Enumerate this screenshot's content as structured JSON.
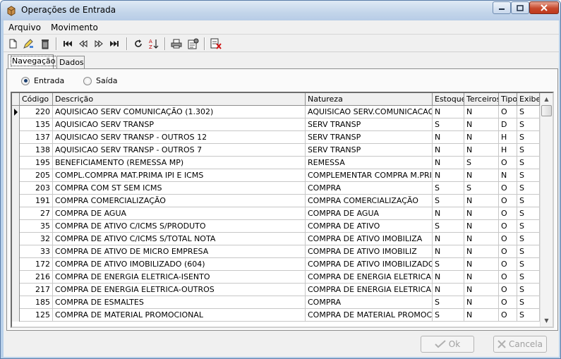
{
  "window": {
    "title": "Operações de Entrada"
  },
  "menu": {
    "items": [
      "Arquivo",
      "Movimento"
    ]
  },
  "toolbar": {
    "icons": [
      "new-icon",
      "edit-icon",
      "delete-icon",
      "first-record-icon",
      "previous-record-icon",
      "next-record-icon",
      "last-record-icon",
      "refresh-icon",
      "sort-icon",
      "print-icon",
      "properties-icon",
      "exit-icon"
    ]
  },
  "tabs": [
    {
      "label": "Navegação",
      "active": true
    },
    {
      "label": "Dados",
      "active": false
    }
  ],
  "filter": {
    "options": [
      {
        "label": "Entrada",
        "selected": true
      },
      {
        "label": "Saída",
        "selected": false
      }
    ]
  },
  "grid": {
    "columns": [
      "Código",
      "Descrição",
      "Natureza",
      "Estoque",
      "Terceiros",
      "Tipo",
      "Exibe"
    ],
    "rows": [
      [
        "220",
        "AQUISICAO SERV COMUNICAÇÃO (1.302)",
        "AQUISICAO SERV.COMUNICACAO",
        "N",
        "N",
        "O",
        "S"
      ],
      [
        "135",
        "AQUISICAO SERV TRANSP",
        "SERV TRANSP",
        "S",
        "N",
        "D",
        "S"
      ],
      [
        "137",
        "AQUISICAO SERV TRANSP - OUTROS 12",
        "SERV TRANSP",
        "N",
        "N",
        "H",
        "S"
      ],
      [
        "138",
        "AQUISICAO SERV TRANSP - OUTROS 7",
        "SERV TRANSP",
        "N",
        "N",
        "H",
        "S"
      ],
      [
        "195",
        "BENEFICIAMENTO (REMESSA MP)",
        "REMESSA",
        "N",
        "S",
        "O",
        "S"
      ],
      [
        "205",
        "COMPL.COMPRA MAT.PRIMA IPI E ICMS",
        "COMPLEMENTAR COMPRA M.PRIM",
        "N",
        "N",
        "N",
        "S"
      ],
      [
        "203",
        "COMPRA COM ST SEM ICMS",
        "COMPRA",
        "S",
        "S",
        "O",
        "S"
      ],
      [
        "191",
        "COMPRA COMERCIALIZAÇÃO",
        "COMPRA COMERCIALIZAÇÃO",
        "S",
        "N",
        "O",
        "S"
      ],
      [
        "27",
        "COMPRA DE AGUA",
        "COMPRA DE AGUA",
        "N",
        "N",
        "O",
        "S"
      ],
      [
        "35",
        "COMPRA DE ATIVO C/ICMS S/PRODUTO",
        "COMPRA DE ATIVO",
        "S",
        "N",
        "O",
        "S"
      ],
      [
        "32",
        "COMPRA DE ATIVO C/ICMS S/TOTAL NOTA",
        "COMPRA DE ATIVO IMOBILIZA",
        "N",
        "N",
        "O",
        "S"
      ],
      [
        "33",
        "COMPRA DE ATIVO DE MICRO EMPRESA",
        "COMPRA DE ATIVO IMOBILIZ",
        "N",
        "N",
        "O",
        "S"
      ],
      [
        "172",
        "COMPRA DE ATIVO IMOBILIZADO (604)",
        "COMPRA DE ATIVO IMOBILIZADO",
        "S",
        "N",
        "O",
        "S"
      ],
      [
        "216",
        "COMPRA DE ENERGIA ELETRICA-ISENTO",
        "COMPRA DE ENERGIA ELETRICA",
        "N",
        "N",
        "O",
        "S"
      ],
      [
        "217",
        "COMPRA DE ENERGIA ELETRICA-OUTROS",
        "COMPRA DE ENERGIA ELETRICA",
        "N",
        "N",
        "O",
        "S"
      ],
      [
        "185",
        "COMPRA DE ESMALTES",
        "COMPRA",
        "S",
        "N",
        "O",
        "S"
      ],
      [
        "125",
        "COMPRA DE MATERIAL PROMOCIONAL",
        "COMPRA DE MATERIAL PROMOCI",
        "S",
        "N",
        "O",
        "S"
      ]
    ]
  },
  "buttons": {
    "ok_label": "Ok",
    "cancel_label": "Cancela"
  }
}
